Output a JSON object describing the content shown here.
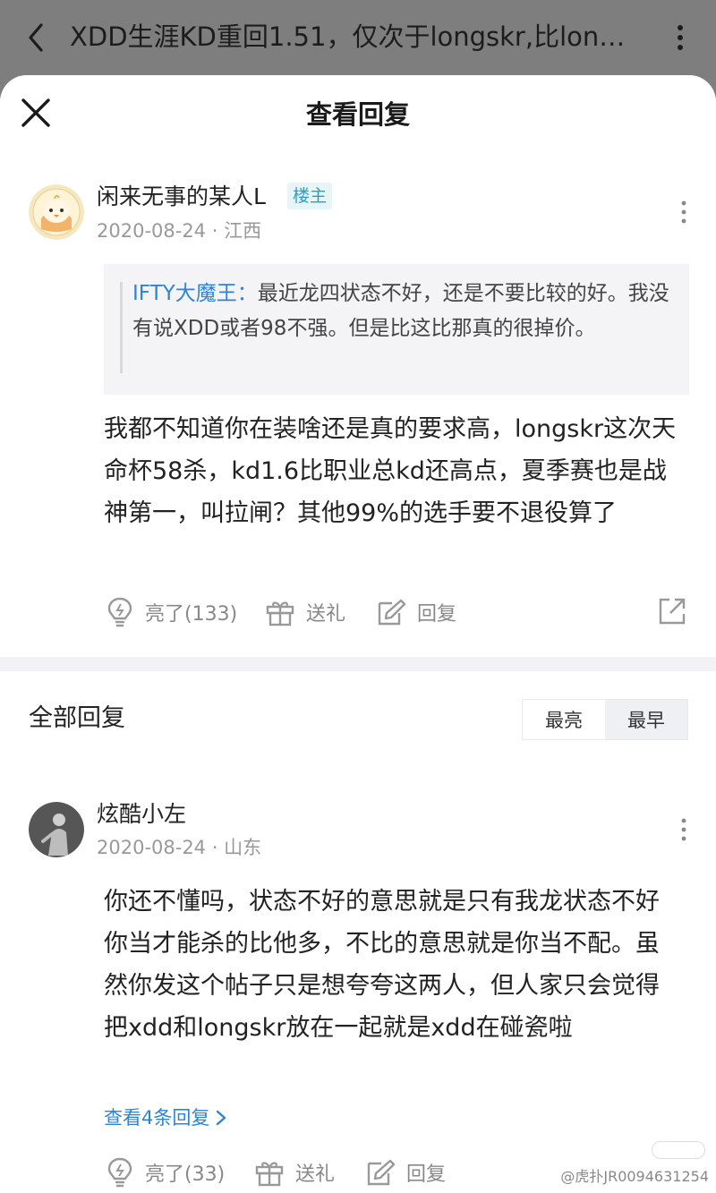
{
  "header": {
    "title": "XDD生涯KD重回1.51，仅次于longskr,比lon…"
  },
  "sheet": {
    "title": "查看回复"
  },
  "main_post": {
    "username": "闲来无事的某人L",
    "badge": "楼主",
    "date": "2020-08-24",
    "location": "江西",
    "meta": "2020-08-24 · 江西",
    "quote_name": "IFTY大魔王：",
    "quote_text": "最近龙四状态不好，还是不要比较的好。我没有说XDD或者98不强。但是比这比那真的很掉价。",
    "content": "我都不知道你在装啥还是真的要求高，longskr这次天命杯58杀，kd1.6比职业总kd还高点，夏季赛也是战神第一，叫拉闸？其他99%的选手要不退役算了",
    "actions": {
      "like": "亮了(133)",
      "gift": "送礼",
      "reply": "回复"
    }
  },
  "replies_section": {
    "title": "全部回复",
    "sort_options": [
      "最亮",
      "最早"
    ],
    "selected_sort": "最早"
  },
  "reply": {
    "username": "炫酷小左",
    "meta": "2020-08-24 · 山东",
    "content": "你还不懂吗，状态不好的意思就是只有我龙状态不好你当才能杀的比他多，不比的意思就是你当不配。虽然你发这个帖子只是想夸夸这两人，但人家只会觉得把xdd和longskr放在一起就是xdd在碰瓷啦",
    "view_more": "查看4条回复",
    "actions": {
      "like": "亮了(33)",
      "gift": "送礼",
      "reply": "回复"
    }
  },
  "watermark": "@虎扑JR0094631254",
  "colors": {
    "link": "#2f84d1",
    "badge": "#29a0c2",
    "meta": "#999999",
    "topbar": "#7e7e7e"
  }
}
